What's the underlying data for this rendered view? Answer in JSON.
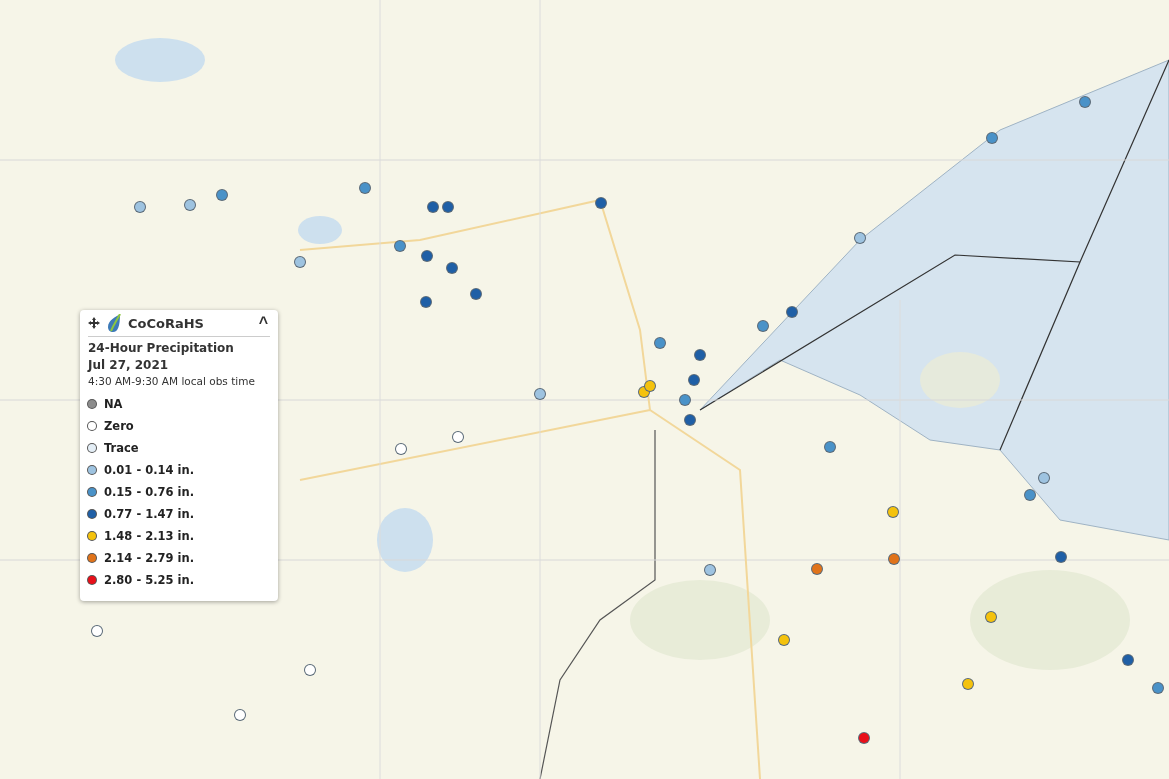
{
  "legend": {
    "brand": "CoCoRaHS",
    "collapse_symbol": "^",
    "title": "24-Hour Precipitation",
    "date": "Jul 27, 2021",
    "time_note": "4:30 AM-9:30 AM local obs time",
    "items": [
      {
        "label": "NA",
        "color": "#8c8c8c"
      },
      {
        "label": "Zero",
        "color": "#ffffff"
      },
      {
        "label": "Trace",
        "color": "#e4eef6"
      },
      {
        "label": "0.01 - 0.14 in.",
        "color": "#9ec3e0"
      },
      {
        "label": "0.15 - 0.76 in.",
        "color": "#4a92c8"
      },
      {
        "label": "0.77 - 1.47 in.",
        "color": "#1f5fa6"
      },
      {
        "label": "1.48 - 2.13 in.",
        "color": "#f4c20d"
      },
      {
        "label": "2.14 - 2.79 in.",
        "color": "#e0731a"
      },
      {
        "label": "2.80 - 5.25 in.",
        "color": "#e8101a"
      }
    ]
  },
  "stations": [
    {
      "color": "#9ec3e0"
    },
    {
      "color": "#4a92c8"
    },
    {
      "color": "#1f5fa6"
    },
    {
      "color": "#1f5fa6"
    },
    {
      "color": "#4a92c8"
    },
    {
      "color": "#9ec3e0"
    },
    {
      "color": "#1f5fa6"
    },
    {
      "color": "#1f5fa6"
    },
    {
      "color": "#4a92c8"
    },
    {
      "color": "#9ec3e0"
    },
    {
      "color": "#1f5fa6"
    },
    {
      "color": "#1f5fa6"
    },
    {
      "color": "#1f5fa6"
    },
    {
      "color": "#f4c20d"
    },
    {
      "color": "#4a92c8"
    },
    {
      "color": "#1f5fa6"
    },
    {
      "color": "#1f5fa6"
    },
    {
      "color": "#4a92c8"
    },
    {
      "color": "#1f5fa6"
    },
    {
      "color": "#f4c20d"
    },
    {
      "color": "#e0731a"
    },
    {
      "color": "#e0731a"
    },
    {
      "color": "#f4c20d"
    },
    {
      "color": "#f4c20d"
    },
    {
      "color": "#e8101a"
    },
    {
      "color": "#f4c20d"
    },
    {
      "color": "#4a92c8"
    },
    {
      "color": "#9ec3e0"
    },
    {
      "color": "#ffffff"
    },
    {
      "color": "#ffffff"
    },
    {
      "color": "#ffffff"
    },
    {
      "color": "#ffffff"
    },
    {
      "color": "#ffffff"
    },
    {
      "color": "#9ec3e0"
    },
    {
      "color": "#4a92c8"
    },
    {
      "color": "#1f5fa6"
    },
    {
      "color": "#9ec3e0"
    },
    {
      "color": "#4a92c8"
    },
    {
      "color": "#1f5fa6"
    },
    {
      "color": "#4a92c8"
    },
    {
      "color": "#9ec3e0"
    },
    {
      "color": "#4a92c8"
    },
    {
      "color": "#f4c20d"
    },
    {
      "color": "#1f5fa6"
    },
    {
      "color": "#4a92c8"
    }
  ]
}
